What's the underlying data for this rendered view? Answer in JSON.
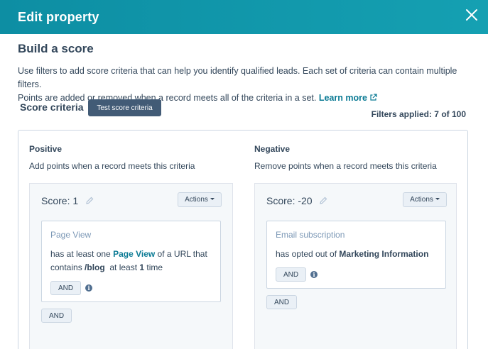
{
  "header": {
    "title": "Edit property",
    "close_icon": "close-icon"
  },
  "main": {
    "title": "Build a score",
    "description_1": "Use filters to add score criteria that can help you identify qualified leads. Each set of criteria can contain multiple filters.",
    "description_2": "Points are added or removed when a record meets all of the criteria in a set.",
    "learn_more": "Learn more",
    "criteria_label": "Score criteria",
    "test_button": "Test score criteria",
    "filters_applied": "Filters applied: 7 of 100"
  },
  "positive": {
    "heading": "Positive",
    "subheading": "Add points when a record meets this criteria",
    "score": "Score: 1",
    "actions": "Actions",
    "card": {
      "title": "Page View",
      "t1": "has at least one ",
      "link": "Page View",
      "t2": " of a URL that",
      "t3": "contains ",
      "bold1": "/blog",
      "t4": "  at least ",
      "bold2": "1",
      "t5": " time",
      "and_inner": "AND"
    },
    "and_outer": "AND"
  },
  "negative": {
    "heading": "Negative",
    "subheading": "Remove points when a record meets this criteria",
    "score": "Score: -20",
    "actions": "Actions",
    "card": {
      "title": "Email subscription",
      "t1": "has opted out of ",
      "bold1": "Marketing Information",
      "and_inner": "AND"
    },
    "and_outer": "AND"
  },
  "colors": {
    "header": "#0d8ea3",
    "link": "#0a7a94",
    "dark_button": "#425b76",
    "panel": "#f5f8fa"
  }
}
